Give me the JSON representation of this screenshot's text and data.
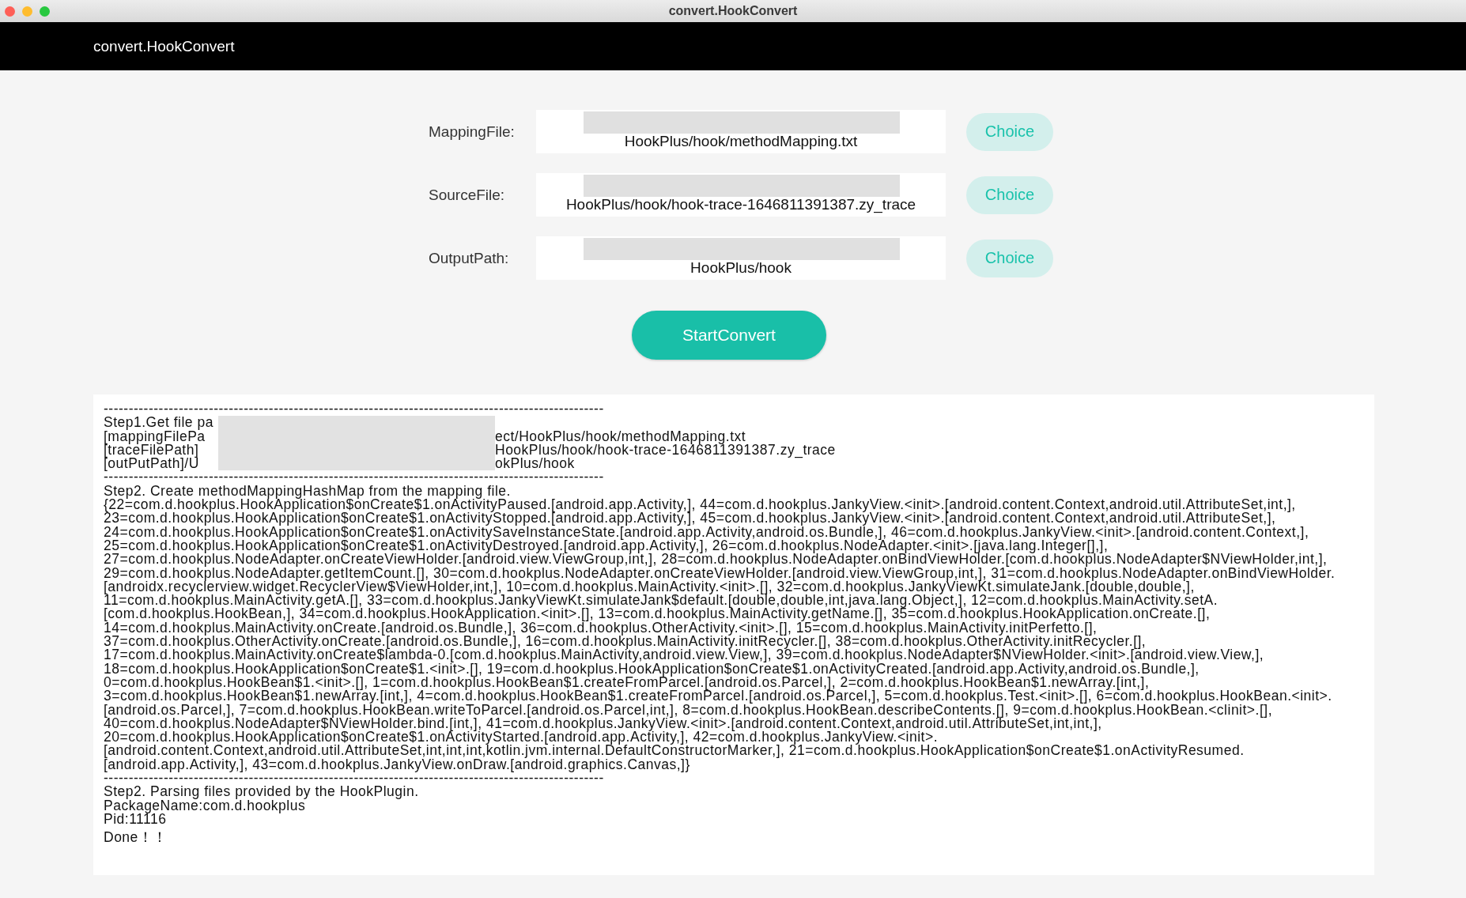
{
  "window": {
    "title": "convert.HookConvert"
  },
  "header": {
    "title": "convert.HookConvert"
  },
  "fields": [
    {
      "label": "MappingFile:",
      "value": "HookPlus/hook/methodMapping.txt",
      "button": "Choice"
    },
    {
      "label": "SourceFile:",
      "value": "HookPlus/hook/hook-trace-1646811391387.zy_trace",
      "button": "Choice"
    },
    {
      "label": "OutputPath:",
      "value": "HookPlus/hook",
      "button": "Choice"
    }
  ],
  "start_button": "StartConvert",
  "log": {
    "separator": "----------------------------------------------------------------------------------------------------",
    "path_lines": [
      {
        "head": "Step1.Get file pa"
      },
      {
        "head": "[mappingFilePa",
        "tail": "ect/HookPlus/hook/methodMapping.txt"
      },
      {
        "head": "[traceFilePath]",
        "tail": "HookPlus/hook/hook-trace-1646811391387.zy_trace"
      },
      {
        "head": "[outPutPath]/U",
        "tail": "okPlus/hook"
      }
    ],
    "mapping_lines": [
      "Step2. Create methodMappingHashMap from the mapping file.",
      "{22=com.d.hookplus.HookApplication$onCreate$1.onActivityPaused.[android.app.Activity,], 44=com.d.hookplus.JankyView.<init>.[android.content.Context,android.util.AttributeSet,int,],",
      "23=com.d.hookplus.HookApplication$onCreate$1.onActivityStopped.[android.app.Activity,], 45=com.d.hookplus.JankyView.<init>.[android.content.Context,android.util.AttributeSet,],",
      "24=com.d.hookplus.HookApplication$onCreate$1.onActivitySaveInstanceState.[android.app.Activity,android.os.Bundle,], 46=com.d.hookplus.JankyView.<init>.[android.content.Context,],",
      "25=com.d.hookplus.HookApplication$onCreate$1.onActivityDestroyed.[android.app.Activity,], 26=com.d.hookplus.NodeAdapter.<init>.[java.lang.Integer[],],",
      "27=com.d.hookplus.NodeAdapter.onCreateViewHolder.[android.view.ViewGroup,int,], 28=com.d.hookplus.NodeAdapter.onBindViewHolder.[com.d.hookplus.NodeAdapter$NViewHolder,int,],",
      "29=com.d.hookplus.NodeAdapter.getItemCount.[], 30=com.d.hookplus.NodeAdapter.onCreateViewHolder.[android.view.ViewGroup,int,], 31=com.d.hookplus.NodeAdapter.onBindViewHolder.",
      "[androidx.recyclerview.widget.RecyclerView$ViewHolder,int,], 10=com.d.hookplus.MainActivity.<init>.[], 32=com.d.hookplus.JankyViewKt.simulateJank.[double,double,],",
      "11=com.d.hookplus.MainActivity.getA.[], 33=com.d.hookplus.JankyViewKt.simulateJank$default.[double,double,int,java.lang.Object,], 12=com.d.hookplus.MainActivity.setA.",
      "[com.d.hookplus.HookBean,], 34=com.d.hookplus.HookApplication.<init>.[], 13=com.d.hookplus.MainActivity.getName.[], 35=com.d.hookplus.HookApplication.onCreate.[],",
      "14=com.d.hookplus.MainActivity.onCreate.[android.os.Bundle,], 36=com.d.hookplus.OtherActivity.<init>.[], 15=com.d.hookplus.MainActivity.initPerfetto.[],",
      "37=com.d.hookplus.OtherActivity.onCreate.[android.os.Bundle,], 16=com.d.hookplus.MainActivity.initRecycler.[], 38=com.d.hookplus.OtherActivity.initRecycler.[],",
      "17=com.d.hookplus.MainActivity.onCreate$lambda-0.[com.d.hookplus.MainActivity,android.view.View,], 39=com.d.hookplus.NodeAdapter$NViewHolder.<init>.[android.view.View,],",
      "18=com.d.hookplus.HookApplication$onCreate$1.<init>.[], 19=com.d.hookplus.HookApplication$onCreate$1.onActivityCreated.[android.app.Activity,android.os.Bundle,],",
      "0=com.d.hookplus.HookBean$1.<init>.[], 1=com.d.hookplus.HookBean$1.createFromParcel.[android.os.Parcel,], 2=com.d.hookplus.HookBean$1.newArray.[int,],",
      "3=com.d.hookplus.HookBean$1.newArray.[int,], 4=com.d.hookplus.HookBean$1.createFromParcel.[android.os.Parcel,], 5=com.d.hookplus.Test.<init>.[], 6=com.d.hookplus.HookBean.<init>.",
      "[android.os.Parcel,], 7=com.d.hookplus.HookBean.writeToParcel.[android.os.Parcel,int,], 8=com.d.hookplus.HookBean.describeContents.[], 9=com.d.hookplus.HookBean.<clinit>.[],",
      "40=com.d.hookplus.NodeAdapter$NViewHolder.bind.[int,], 41=com.d.hookplus.JankyView.<init>.[android.content.Context,android.util.AttributeSet,int,int,],",
      "20=com.d.hookplus.HookApplication$onCreate$1.onActivityStarted.[android.app.Activity,], 42=com.d.hookplus.JankyView.<init>.",
      "[android.content.Context,android.util.AttributeSet,int,int,int,kotlin.jvm.internal.DefaultConstructorMarker,], 21=com.d.hookplus.HookApplication$onCreate$1.onActivityResumed.",
      "[android.app.Activity,], 43=com.d.hookplus.JankyView.onDraw.[android.graphics.Canvas,]}"
    ],
    "parse_lines": [
      "Step2. Parsing files provided by the HookPlugin.",
      "PackageName:com.d.hookplus",
      "Pid:11116"
    ],
    "done": "Done！！"
  }
}
